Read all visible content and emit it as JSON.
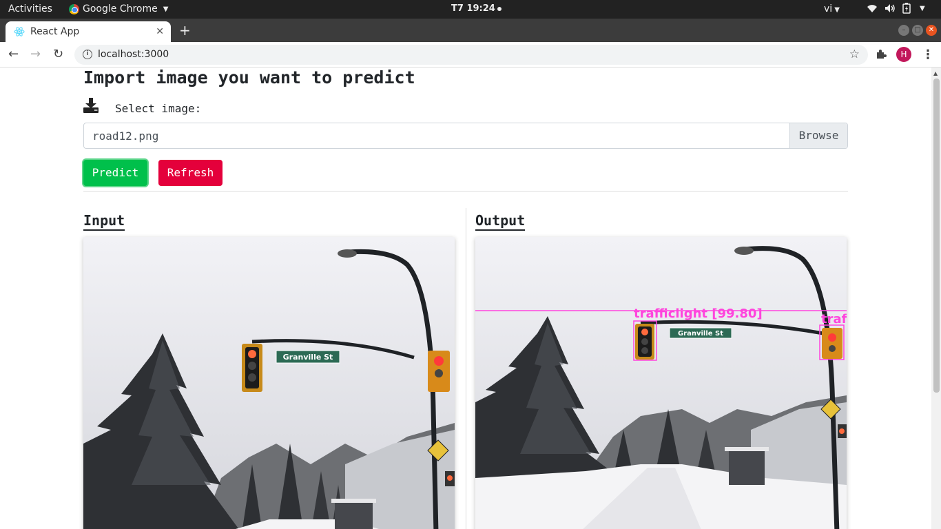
{
  "os_bar": {
    "activities": "Activities",
    "app_name": "Google Chrome",
    "clock": "T7 19:24",
    "language": "vi"
  },
  "browser": {
    "tab_title": "React App",
    "url": "localhost:3000",
    "profile_initial": "H"
  },
  "page": {
    "title": "Import image you want to predict",
    "select_label": "Select image:",
    "file_name": "road12.png",
    "browse_label": "Browse",
    "predict_label": "Predict",
    "refresh_label": "Refresh",
    "input_heading": "Input",
    "output_heading": "Output"
  },
  "images": {
    "input": {
      "sign_text": "Granville St"
    },
    "output": {
      "sign_text": "Granville St",
      "detection_label": "trafficlight [99.80]",
      "detection_label_partial": "traf",
      "detection_color": "#ff44dd"
    }
  },
  "colors": {
    "predict": "#00c04b",
    "refresh": "#e4003b",
    "profile": "#c2185b"
  }
}
